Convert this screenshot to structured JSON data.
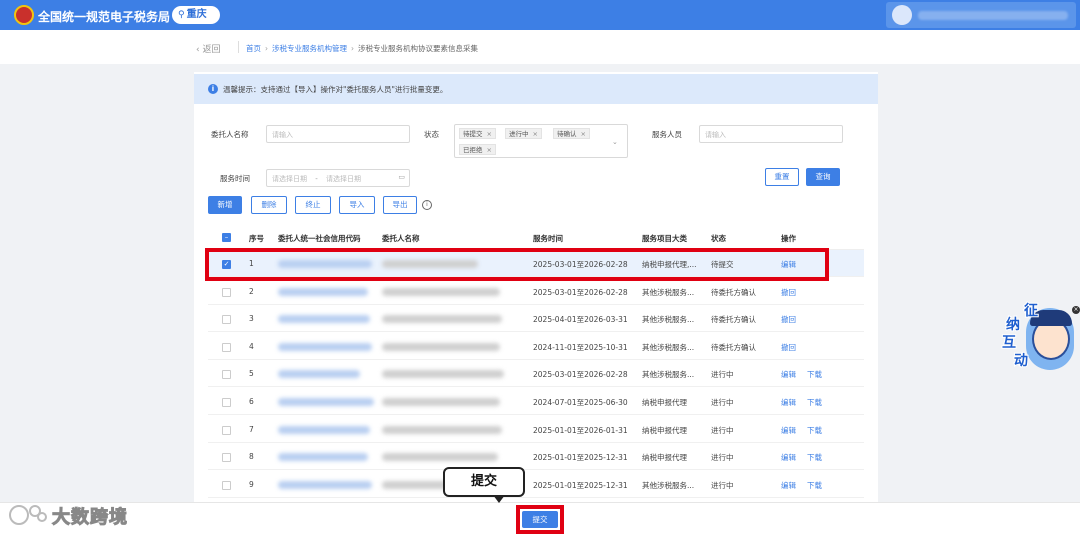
{
  "header": {
    "app_title": "全国统一规范电子税务局",
    "region": "重庆",
    "colors": {
      "primary": "#3d7fe5",
      "highlight": "#e00012"
    }
  },
  "breadcrumb": {
    "back": "返回",
    "items": [
      "首页",
      "涉税专业服务机构管理",
      "涉税专业服务机构协议要素信息采集"
    ]
  },
  "tip": {
    "icon": "info-icon",
    "text": "温馨提示：支持通过【导入】操作对\"委托服务人员\"进行批量变更。"
  },
  "filters": {
    "client_name_label": "委托人名称",
    "client_name_placeholder": "请输入",
    "status_label": "状态",
    "status_tags": [
      "待提交",
      "进行中",
      "待确认",
      "已拒绝"
    ],
    "service_staff_label": "服务人员",
    "service_staff_placeholder": "请输入",
    "service_time_label": "服务时间",
    "date_start_placeholder": "请选择日期",
    "date_sep": "-",
    "date_end_placeholder": "请选择日期",
    "reset": "重置",
    "search": "查询"
  },
  "toolbar": {
    "add": "新增",
    "delete": "删除",
    "terminate": "终止",
    "import": "导入",
    "export": "导出"
  },
  "table": {
    "columns": [
      "序号",
      "委托人统一社会信用代码",
      "委托人名称",
      "服务时间",
      "服务项目大类",
      "状态",
      "操作"
    ],
    "rows": [
      {
        "no": "1",
        "time": "2025-03-01至2026-02-28",
        "category": "纳税申报代理,...",
        "status": "待提交",
        "actions": [
          "编辑"
        ],
        "checked": true
      },
      {
        "no": "2",
        "time": "2025-03-01至2026-02-28",
        "category": "其他涉税服务...",
        "status": "待委托方确认",
        "actions": [
          "撤回"
        ],
        "checked": false
      },
      {
        "no": "3",
        "time": "2025-04-01至2026-03-31",
        "category": "其他涉税服务...",
        "status": "待委托方确认",
        "actions": [
          "撤回"
        ],
        "checked": false
      },
      {
        "no": "4",
        "time": "2024-11-01至2025-10-31",
        "category": "其他涉税服务...",
        "status": "待委托方确认",
        "actions": [
          "撤回"
        ],
        "checked": false
      },
      {
        "no": "5",
        "time": "2025-03-01至2026-02-28",
        "category": "其他涉税服务...",
        "status": "进行中",
        "actions": [
          "编辑",
          "下载"
        ],
        "checked": false
      },
      {
        "no": "6",
        "time": "2024-07-01至2025-06-30",
        "category": "纳税申报代理",
        "status": "进行中",
        "actions": [
          "编辑",
          "下载"
        ],
        "checked": false
      },
      {
        "no": "7",
        "time": "2025-01-01至2026-01-31",
        "category": "纳税申报代理",
        "status": "进行中",
        "actions": [
          "编辑",
          "下载"
        ],
        "checked": false
      },
      {
        "no": "8",
        "time": "2025-01-01至2025-12-31",
        "category": "纳税申报代理",
        "status": "进行中",
        "actions": [
          "编辑",
          "下载"
        ],
        "checked": false
      },
      {
        "no": "9",
        "time": "2025-01-01至2025-12-31",
        "category": "其他涉税服务...",
        "status": "进行中",
        "actions": [
          "编辑",
          "下载"
        ],
        "checked": false
      }
    ]
  },
  "footer": {
    "submit": "提交"
  },
  "annotation": {
    "callout": "提交"
  },
  "watermark": "大数跨境",
  "mascot": {
    "chars": [
      "征",
      "纳",
      "互",
      "动"
    ]
  }
}
